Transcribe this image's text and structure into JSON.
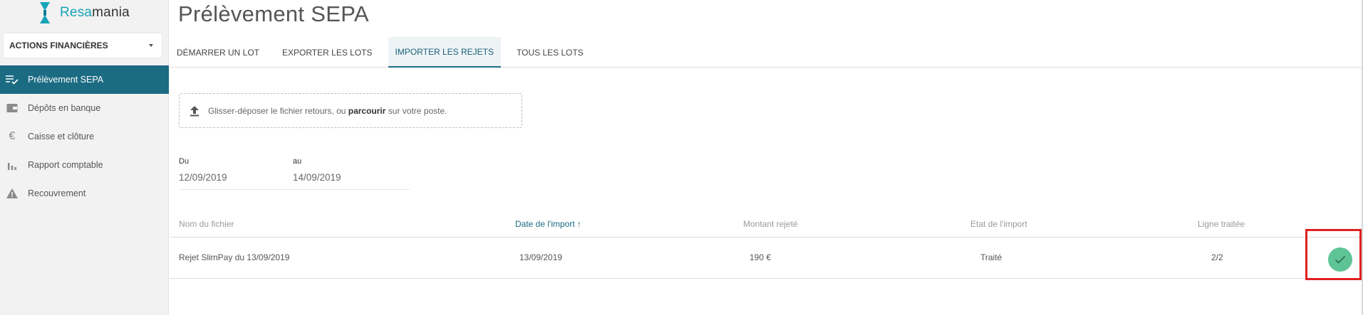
{
  "brand": {
    "name_accent": "Resa",
    "name_rest": "mania",
    "accent_color": "#16a3b8"
  },
  "sidebar": {
    "section_label": "ACTIONS FINANCIÈRES",
    "items": [
      {
        "label": "Prélèvement SEPA",
        "icon": "checklist-icon",
        "active": true
      },
      {
        "label": "Dépôts en banque",
        "icon": "wallet-icon",
        "active": false
      },
      {
        "label": "Caisse et clôture",
        "icon": "euro-icon",
        "active": false
      },
      {
        "label": "Rapport comptable",
        "icon": "bar-chart-icon",
        "active": false
      },
      {
        "label": "Recouvrement",
        "icon": "warning-icon",
        "active": false
      }
    ]
  },
  "header": {
    "title": "Prélèvement SEPA"
  },
  "tabs": [
    {
      "label": "DÉMARRER UN LOT",
      "active": false
    },
    {
      "label": "EXPORTER LES LOTS",
      "active": false
    },
    {
      "label": "IMPORTER LES REJETS",
      "active": true
    },
    {
      "label": "TOUS LES LOTS",
      "active": false
    }
  ],
  "dropzone": {
    "text_before": "Glisser-déposer le fichier retours, ou ",
    "link": "parcourir",
    "text_after": " sur votre poste."
  },
  "filters": {
    "from_label": "Du",
    "from_value": "12/09/2019",
    "to_label": "au",
    "to_value": "14/09/2019"
  },
  "table": {
    "headers": {
      "file": "Nom du fichier",
      "import_date": "Date de l'import ↑",
      "amount": "Montant rejeté",
      "state": "Etat de l'import",
      "lines": "Ligne traitée"
    },
    "rows": [
      {
        "file": "Rejet SlimPay du 13/09/2019",
        "import_date": "13/09/2019",
        "amount": "190 €",
        "state": "Traité",
        "lines": "2/2",
        "status": "success"
      }
    ]
  },
  "colors": {
    "primary": "#1b6b82",
    "success": "#5ec496",
    "highlight": "#e02020"
  }
}
